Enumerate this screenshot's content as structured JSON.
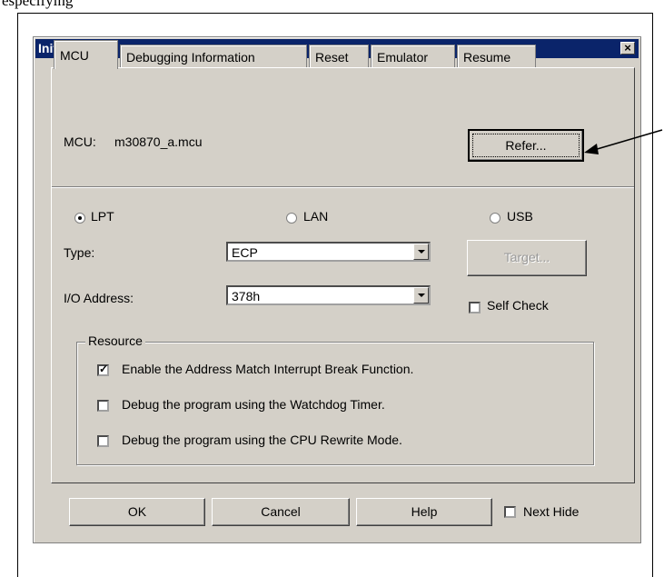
{
  "caption": "especifying",
  "dialog": {
    "title": "Init",
    "close_glyph": "×",
    "tabs": [
      "MCU",
      "Debugging Information",
      "Reset",
      "Emulator",
      "Resume"
    ],
    "active_tab": "MCU",
    "mcu": {
      "label": "MCU:",
      "value": "m30870_a.mcu",
      "refer_button": "Refer..."
    },
    "connection": {
      "options": [
        "LPT",
        "LAN",
        "USB"
      ],
      "selected": "LPT"
    },
    "type": {
      "label": "Type:",
      "value": "ECP"
    },
    "io_address": {
      "label": "I/O Address:",
      "value": "378h"
    },
    "target_button": "Target...",
    "self_check": {
      "label": "Self Check",
      "checked": false
    },
    "resource": {
      "title": "Resource",
      "items": [
        {
          "label": "Enable the Address Match Interrupt Break Function.",
          "checked": true
        },
        {
          "label": "Debug the program using the Watchdog Timer.",
          "checked": false
        },
        {
          "label": "Debug the program using the CPU Rewrite Mode.",
          "checked": false
        }
      ]
    },
    "footer": {
      "ok": "OK",
      "cancel": "Cancel",
      "help": "Help",
      "next_hide": {
        "label": "Next Hide",
        "checked": false
      }
    }
  }
}
